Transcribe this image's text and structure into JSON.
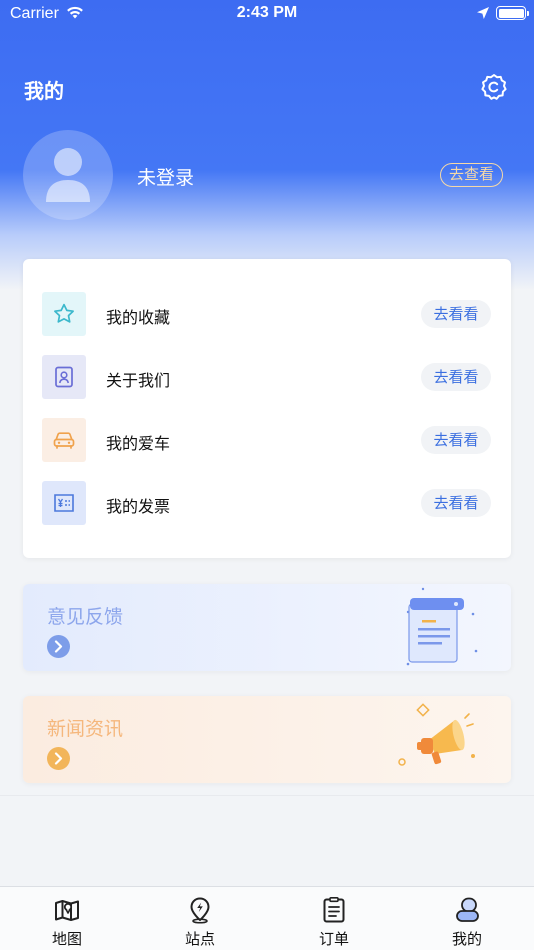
{
  "status_bar": {
    "carrier": "Carrier",
    "time": "2:43 PM"
  },
  "header": {
    "title": "我的",
    "login_status": "未登录",
    "view_button": "去查看"
  },
  "menu": {
    "items": [
      {
        "label": "我的收藏",
        "button": "去看看",
        "icon": "star-icon",
        "icon_bg": "#e3f6f9"
      },
      {
        "label": "关于我们",
        "button": "去看看",
        "icon": "contact-card-icon",
        "icon_bg": "#e6e8f7"
      },
      {
        "label": "我的爱车",
        "button": "去看看",
        "icon": "car-icon",
        "icon_bg": "#fbeee4"
      },
      {
        "label": "我的发票",
        "button": "去看看",
        "icon": "invoice-icon",
        "icon_bg": "#dfe7fb"
      }
    ]
  },
  "banners": {
    "feedback": {
      "title": "意见反馈"
    },
    "news": {
      "title": "新闻资讯"
    }
  },
  "tab_bar": {
    "tabs": [
      {
        "label": "地图",
        "icon": "map-icon"
      },
      {
        "label": "站点",
        "icon": "station-pin-icon"
      },
      {
        "label": "订单",
        "icon": "order-list-icon"
      },
      {
        "label": "我的",
        "icon": "profile-icon"
      }
    ],
    "active": "我的"
  },
  "colors": {
    "header_blue": "#3d6cf2",
    "accent_blue": "#3b6fe0",
    "gold": "#f5d9a8"
  }
}
